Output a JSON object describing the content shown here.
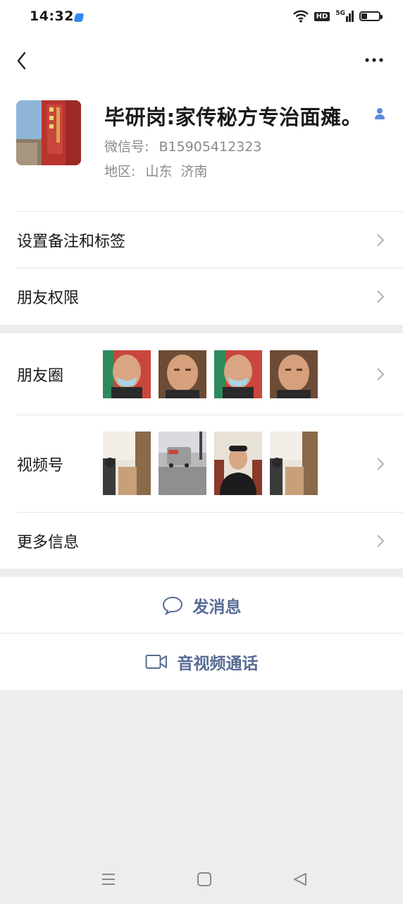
{
  "status_bar": {
    "time": "14:32",
    "hd": "HD",
    "signal": "5G",
    "battery_level": 0.35
  },
  "header": {
    "back_icon": "chevron-left-icon",
    "more_icon": "more-dots-icon"
  },
  "profile": {
    "name": "毕研岗:家传秘方专治面瘫。",
    "wechat_id_label": "微信号:",
    "wechat_id": "B15905412323",
    "region_label": "地区:",
    "region": "山东  济南",
    "gender_icon": "male-icon"
  },
  "menu": {
    "remark_label": "设置备注和标签",
    "permissions_label": "朋友权限",
    "moments_label": "朋友圈",
    "channels_label": "视频号",
    "more_info_label": "更多信息"
  },
  "actions": {
    "message_label": "发消息",
    "call_label": "音视频通话"
  },
  "colors": {
    "link_blue": "#576b95",
    "background": "#ededed",
    "text_primary": "#191919",
    "text_secondary": "#8a8a8a"
  }
}
